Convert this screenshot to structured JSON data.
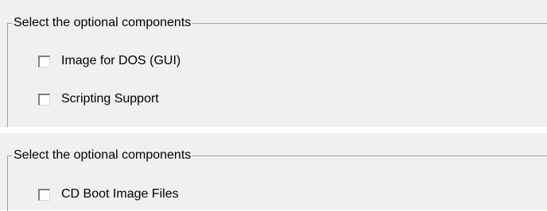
{
  "top_group": {
    "title": "Select the optional components",
    "options": [
      {
        "label": "Image for DOS (GUI)",
        "checked": false
      },
      {
        "label": "Scripting Support",
        "checked": false
      }
    ]
  },
  "bottom_group": {
    "title": "Select the optional components",
    "options": [
      {
        "label": "CD Boot Image Files",
        "checked": false
      }
    ]
  },
  "colors": {
    "panel_background": "#f0f0f0",
    "group_border": "#a0a0a0",
    "checkbox_fill": "#ffffff"
  }
}
